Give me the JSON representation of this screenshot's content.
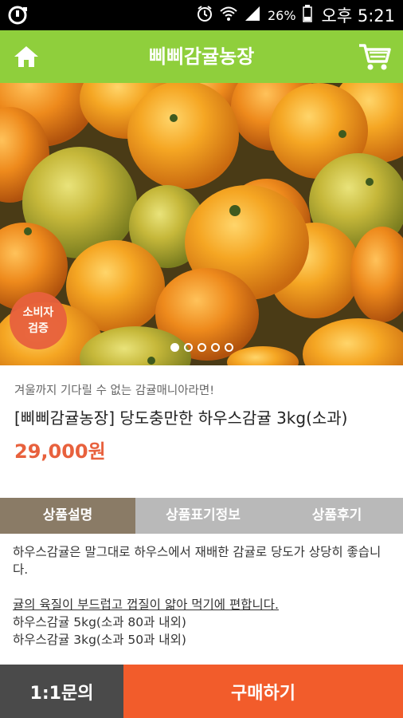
{
  "status_bar": {
    "battery": "26%",
    "time": "오후 5:21",
    "icons": [
      "notification-icon",
      "alarm-icon",
      "wifi-icon",
      "signal-icon",
      "battery-icon"
    ]
  },
  "header": {
    "title": "삐삐감귤농장",
    "home_icon": "home-icon",
    "cart_icon": "cart-icon",
    "color": "#8fcf3c"
  },
  "gallery": {
    "badge_line1": "소비자",
    "badge_line2": "검증",
    "slide_count": 5,
    "active_slide": 0
  },
  "product": {
    "subtitle": "겨울까지 기다릴 수 없는 감귤매니아라면!",
    "name": "[삐삐감귤농장] 당도충만한 하우스감귤 3kg(소과)",
    "price": "29,000원"
  },
  "tabs": [
    {
      "label": "상품설명",
      "active": true
    },
    {
      "label": "상품표기정보",
      "active": false
    },
    {
      "label": "상품후기",
      "active": false
    }
  ],
  "description": {
    "line1": "하우스감귤은 말그대로 하우스에서 재배한 감귤로 당도가 상당히 좋습니다.",
    "line2": "귤의 육질이 부드럽고 껍질이 얇아 먹기에 편합니다.",
    "line3": "하우스감귤 5kg(소과 80과 내외)",
    "line4": "하우스감귤 3kg(소과 50과 내외)"
  },
  "bottom_bar": {
    "inquiry_label": "1:1문의",
    "buy_label": "구매하기"
  },
  "colors": {
    "accent": "#f25c2b",
    "price": "#e8613d",
    "tab_active": "#8a7b66",
    "tab_inactive": "#b9b9b9"
  }
}
